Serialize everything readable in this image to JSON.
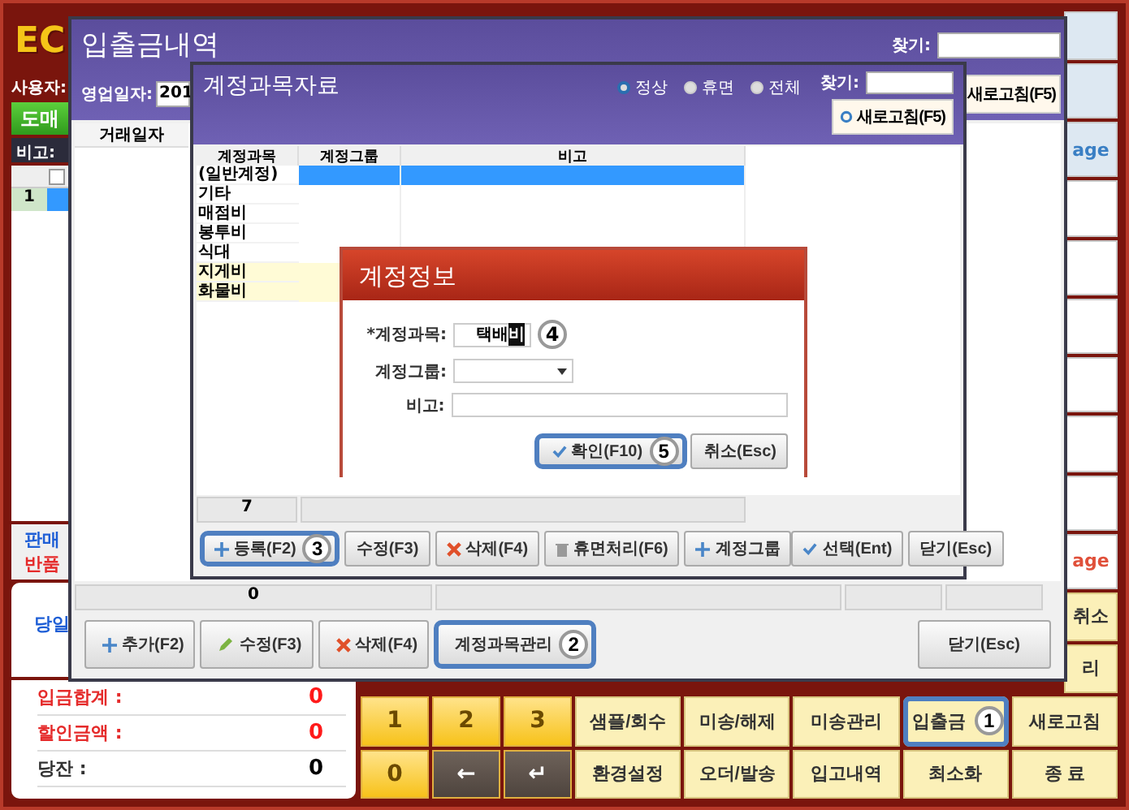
{
  "app": {
    "logo": "EC",
    "user_label": "사용자:",
    "mode_button": "도매",
    "memo_label": "비고:",
    "header_checkbox": {
      "checked": false
    },
    "grid_rows": [
      {
        "number": "1",
        "selected": true
      }
    ],
    "sale_label": "판매",
    "return_label": "반품",
    "summary": [
      {
        "label": "당일",
        "color": "#1f5fd6"
      },
      {
        "label": "입금합계 :",
        "value": "0",
        "color": "#e52b2b"
      },
      {
        "label": "할인금액 :",
        "value": "0",
        "color": "#e52b2b"
      },
      {
        "label": "당잔 :",
        "value": "0",
        "color": "#333333"
      }
    ],
    "side_tiles": [
      {
        "text": "age",
        "color": "#3a7fc4"
      },
      {
        "text": "age",
        "color": "#e0503a"
      }
    ],
    "keypad": [
      {
        "label": "1",
        "kind": "digit"
      },
      {
        "label": "2",
        "kind": "digit"
      },
      {
        "label": "3",
        "kind": "digit"
      },
      {
        "label": "0",
        "kind": "digit"
      },
      {
        "label": "←",
        "kind": "key"
      },
      {
        "label": "↵",
        "kind": "key"
      }
    ],
    "function_buttons": [
      {
        "label": "취소",
        "highlighted": false
      },
      {
        "label": "리",
        "highlighted": false
      },
      {
        "label": "샘플/회수",
        "highlighted": false
      },
      {
        "label": "미송/해제",
        "highlighted": false
      },
      {
        "label": "미송관리",
        "highlighted": false
      },
      {
        "label": "입출금",
        "highlighted": true
      },
      {
        "label": "새로고침",
        "highlighted": false
      },
      {
        "label": "환경설정",
        "highlighted": false
      },
      {
        "label": "오더/발송",
        "highlighted": false
      },
      {
        "label": "입고내역",
        "highlighted": false
      },
      {
        "label": "최소화",
        "highlighted": false
      },
      {
        "label": "종 료",
        "highlighted": false
      }
    ]
  },
  "ledger_window": {
    "title": "입출금내역",
    "date_label": "영업일자:",
    "date_value": "201",
    "search_label": "찾기:",
    "refresh_button": "새로고침(F5)",
    "columns": [
      "거래일자"
    ],
    "footer_cells": [
      "0"
    ],
    "buttons": [
      {
        "label": "추가(F2)",
        "kind": "add",
        "highlighted": false
      },
      {
        "label": "수정(F3)",
        "kind": "edit",
        "highlighted": false
      },
      {
        "label": "삭제(F4)",
        "kind": "delete",
        "highlighted": false
      },
      {
        "label": "계정과목관리",
        "kind": "plain",
        "highlighted": true
      }
    ],
    "close_button": "닫기(Esc)"
  },
  "accounts_window": {
    "title": "계정과목자료",
    "filters": [
      {
        "label": "정상",
        "selected": true
      },
      {
        "label": "휴면",
        "selected": false
      },
      {
        "label": "전체",
        "selected": false
      }
    ],
    "search_label": "찾기:",
    "refresh_button": "새로고침(F5)",
    "columns": [
      "계정과목",
      "계정그룹",
      "비고"
    ],
    "rows": [
      {
        "name": "(일반계정)",
        "selected": true,
        "marked": false
      },
      {
        "name": "기타",
        "selected": false,
        "marked": false
      },
      {
        "name": "매점비",
        "selected": false,
        "marked": false
      },
      {
        "name": "봉투비",
        "selected": false,
        "marked": false
      },
      {
        "name": "식대",
        "selected": false,
        "marked": false
      },
      {
        "name": "지게비",
        "selected": false,
        "marked": true
      },
      {
        "name": "화물비",
        "selected": false,
        "marked": true
      }
    ],
    "count": "7",
    "left_buttons": [
      {
        "label": "등록(F2)",
        "kind": "add",
        "highlighted": true
      },
      {
        "label": "수정(F3)",
        "kind": "plain",
        "highlighted": false
      },
      {
        "label": "삭제(F4)",
        "kind": "delete",
        "highlighted": false
      },
      {
        "label": "휴면처리(F6)",
        "kind": "trash",
        "highlighted": false
      },
      {
        "label": "계정그룹",
        "kind": "add",
        "highlighted": false
      }
    ],
    "right_buttons": [
      {
        "label": "선택(Ent)",
        "kind": "check",
        "highlighted": false
      },
      {
        "label": "닫기(Esc)",
        "kind": "plain",
        "highlighted": false
      }
    ]
  },
  "account_dialog": {
    "title": "계정정보",
    "fields": [
      {
        "label": "*계정과목:",
        "kind": "text",
        "value": "택배",
        "selected_text": "비"
      },
      {
        "label": "계정그룹:",
        "kind": "select"
      },
      {
        "label": "비고:",
        "kind": "wide"
      }
    ],
    "buttons": [
      {
        "label": "확인(F10)",
        "kind": "check",
        "highlighted": true
      },
      {
        "label": "취소(Esc)",
        "kind": "plain",
        "highlighted": false
      }
    ]
  },
  "callouts": [
    "1",
    "2",
    "3",
    "4",
    "5"
  ]
}
